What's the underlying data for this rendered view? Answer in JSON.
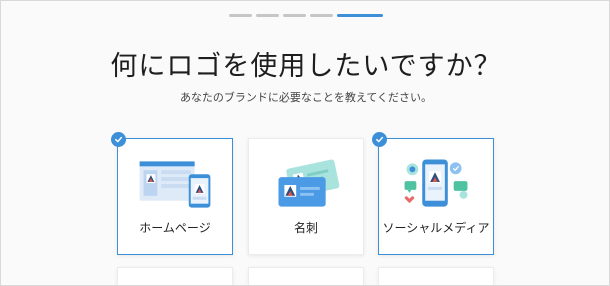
{
  "header": {
    "title": "何にロゴを使用したいですか？",
    "subtitle": "あなたのブランドに必要なことを教えてください。"
  },
  "progress": {
    "total_steps": 5,
    "current_step": 5
  },
  "options": [
    {
      "label": "ホームページ",
      "selected": true,
      "icon": "website-icon"
    },
    {
      "label": "名刺",
      "selected": false,
      "icon": "business-card-icon"
    },
    {
      "label": "ソーシャルメディア",
      "selected": true,
      "icon": "social-media-icon"
    }
  ],
  "colors": {
    "accent": "#3d8fd8",
    "progress_inactive": "#c6c6c6"
  }
}
